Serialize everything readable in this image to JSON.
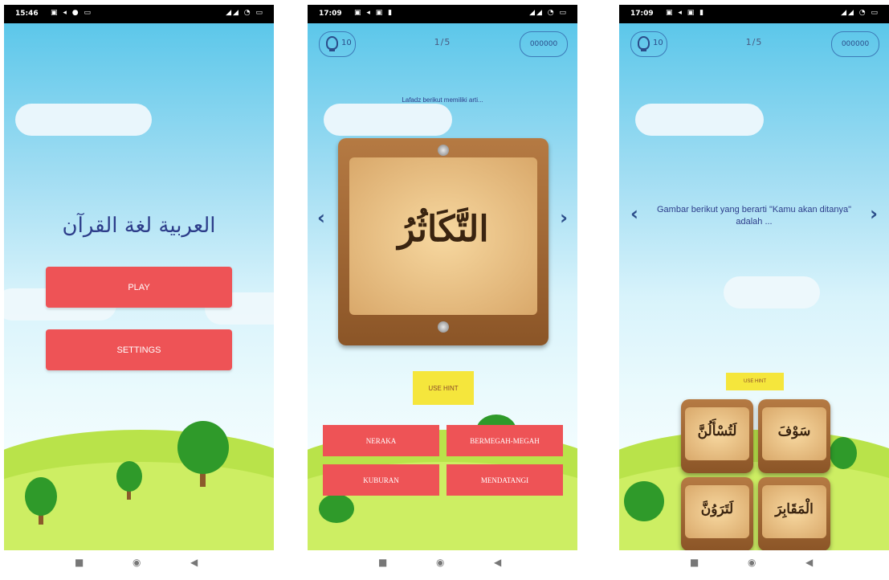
{
  "status_bars": {
    "screen1": {
      "time": "15:46"
    },
    "screen2": {
      "time": "17:09"
    },
    "screen3": {
      "time": "17:09"
    }
  },
  "screen1": {
    "app_title": "العربية لغة القرآن",
    "play_label": "PLAY",
    "settings_label": "SETTINGS"
  },
  "screen2": {
    "hint_count": "10",
    "progress": "1/5",
    "score": "000000",
    "question": "Lafadz berikut memiliki arti...",
    "word": "التَّكَاثُرُ",
    "use_hint_label": "USE HINT",
    "answers": [
      "NERAKA",
      "BERMEGAH-MEGAH",
      "KUBURAN",
      "MENDATANGI"
    ]
  },
  "screen3": {
    "hint_count": "10",
    "progress": "1/5",
    "score": "000000",
    "question": "Gambar berikut yang berarti \"Kamu akan ditanya\" adalah ...",
    "use_hint_label": "USE HINT",
    "tiles": [
      "لَتُسْأَلُنَّ",
      "سَوْفَ",
      "لَتَرَوُنَّ",
      "الْمَقَابِرَ"
    ]
  },
  "icons": {
    "hint": "lightbulb-icon",
    "prev": "chevron-left-icon",
    "next": "chevron-right-icon",
    "nav_recent": "square-icon",
    "nav_home": "circle-icon",
    "nav_back": "triangle-back-icon"
  },
  "colors": {
    "button_red": "#ee5356",
    "hint_yellow": "#f5e63c",
    "title_blue": "#2d3d8a"
  }
}
